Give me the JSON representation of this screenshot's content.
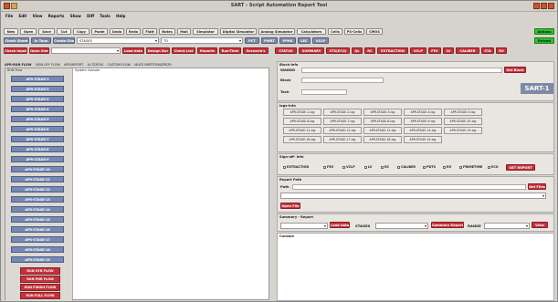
{
  "window": {
    "title": "SART - Script Automation Report Tool"
  },
  "menu": [
    "File",
    "Edit",
    "View",
    "Reports",
    "Show",
    "Diff",
    "Tools",
    "Help"
  ],
  "toolbar1": {
    "buttons": [
      "New",
      "Open",
      "Save",
      "Cut",
      "Copy",
      "Paste",
      "Undo",
      "Redo",
      "Flatt",
      "Notes",
      "Mail",
      "Simulator",
      "Digital Simulator",
      "Analog Simulator",
      "Calculators",
      "Cells",
      "PS-Cells",
      "CMOS"
    ],
    "right_button": "Actions"
  },
  "toolbar2": {
    "check_buttons": [
      "Check Sheet",
      "In Tune",
      "Create Shell"
    ],
    "stages_label": "STAGES",
    "to_label": "TO",
    "buttons": [
      "PCT",
      "PWRT",
      "PPHS",
      "LEC",
      "VCLP"
    ],
    "right_button": "Reload"
  },
  "toolbar3": {
    "left_buttons": [
      "Check Inputs",
      "Open Shell"
    ],
    "buttons": [
      "Load data",
      "Design Dur",
      "Check List",
      "Reports",
      "Run-Time",
      "Scenario's",
      "STATUS",
      "SUMMARY",
      "STS(ECO)",
      "QL",
      "RC",
      "EXTRACTION",
      "VCLP",
      "FEV",
      "LV",
      "CALIBER",
      "STA",
      "RV"
    ]
  },
  "tabs": [
    "APR-RUN FLOW",
    "SIGN-OFF FLOW",
    "APR-REPORT",
    "LV STATUS",
    "CUSTOM FLOW",
    "MULTI PARTITION/ZPATH"
  ],
  "left": {
    "stages_header": "RUN Flow",
    "console_header": "System Console",
    "stages": [
      "APR-STAGE-1",
      "APR-STAGE-2",
      "APR-STAGE-3",
      "APR-STAGE-4",
      "APR-STAGE-5",
      "APR-STAGE-6",
      "APR-STAGE-7",
      "APR-STAGE-8",
      "APR-STAGE-9",
      "APR-STAGE-10",
      "APR-STAGE-11",
      "APR-STAGE-12",
      "APR-STAGE-13",
      "APR-STAGE-14",
      "APR-STAGE-15",
      "APR-STAGE-16",
      "APR-STAGE-17",
      "APR-STAGE-18",
      "APR-STAGE-19"
    ],
    "run_buttons": [
      "RUN SYN FLOW",
      "RUN PNR FLOW",
      "RUN FINISH FLOW",
      "RUN FULL FLOW"
    ]
  },
  "right": {
    "block_info": {
      "header": "Block-Info",
      "wardd_label": "WARDD",
      "block_label": "Block",
      "tech_label": "Tech",
      "get_button": "Get Block",
      "logo": "SART-1"
    },
    "logs_info": {
      "header": "logs-Info",
      "logs": [
        "APR-STAGE-1-log",
        "APR-STAGE-2-log",
        "APR-STAGE-3-log",
        "APR-STAGE-4-log",
        "APR-STAGE-5-log",
        "APR-STAGE-6-log",
        "APR-STAGE-7-log",
        "APR-STAGE-8-log",
        "APR-STAGE-9-log",
        "APR-STAGE-10-log",
        "APR-STAGE-11-log",
        "APR-STAGE-12-log",
        "APR-STAGE-13-log",
        "APR-STAGE-14-log",
        "APR-STAGE-15-log",
        "APR-STAGE-16-log",
        "APR-STAGE-17-log",
        "APR-STAGE-18-log",
        "APR-STAGE-19-log"
      ]
    },
    "signoff": {
      "header": "Sign-off- Info",
      "checks": [
        "EXTRACTION",
        "FEV",
        "VCLP",
        "LV",
        "RC",
        "CALIBER",
        "PDTS",
        "RV",
        "PRIMETIME",
        "ECO"
      ],
      "button": "GET REPORT"
    },
    "report_path": {
      "header": "Report Path",
      "path_label": "Path",
      "get_button": "Get Files",
      "open_button": "Open File"
    },
    "summary": {
      "header": "Summary - Report",
      "load_button": "Load data",
      "stages_label": "STAGES",
      "summary_button": "Summary Report",
      "range_label": "RANGE",
      "view_button": "View"
    },
    "console_header": "Console"
  },
  "colors": {
    "accent_red": "#c3333b",
    "stage_blue": "#7589b3",
    "green": "#2fc12d",
    "steel": "#7d8aa6"
  }
}
